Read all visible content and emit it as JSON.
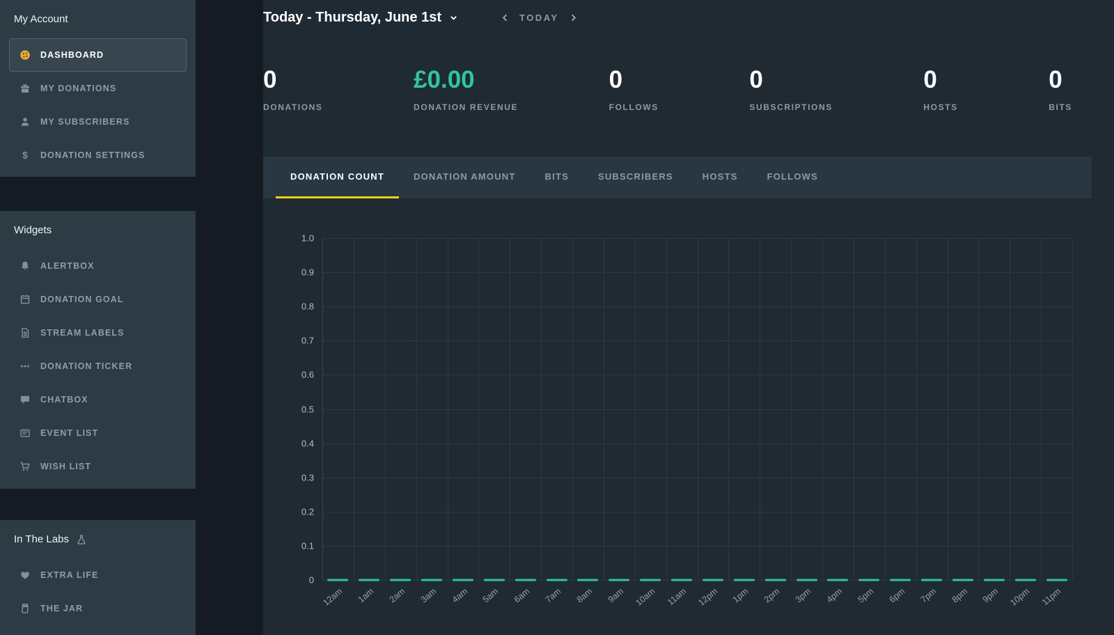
{
  "colors": {
    "teal": "#31c3a2",
    "yellow": "#f8ce15",
    "dashboard_orange": "#eca92c"
  },
  "sidebar": {
    "sections": [
      {
        "title": "My Account",
        "items": [
          {
            "label": "DASHBOARD",
            "icon": "dashboard-icon",
            "active": true
          },
          {
            "label": "MY DONATIONS",
            "icon": "gift-icon",
            "active": false
          },
          {
            "label": "MY SUBSCRIBERS",
            "icon": "person-icon",
            "active": false
          },
          {
            "label": "DONATION SETTINGS",
            "icon": "dollar-icon",
            "active": false
          }
        ]
      },
      {
        "title": "Widgets",
        "items": [
          {
            "label": "ALERTBOX",
            "icon": "bell-icon",
            "active": false
          },
          {
            "label": "DONATION GOAL",
            "icon": "calendar-icon",
            "active": false
          },
          {
            "label": "STREAM LABELS",
            "icon": "document-icon",
            "active": false
          },
          {
            "label": "DONATION TICKER",
            "icon": "ticker-icon",
            "active": false
          },
          {
            "label": "CHATBOX",
            "icon": "chat-icon",
            "active": false
          },
          {
            "label": "EVENT LIST",
            "icon": "list-icon",
            "active": false
          },
          {
            "label": "WISH LIST",
            "icon": "cart-icon",
            "active": false
          }
        ]
      },
      {
        "title": "In The Labs",
        "title_icon": "flask-icon",
        "items": [
          {
            "label": "EXTRA LIFE",
            "icon": "heart-icon",
            "active": false
          },
          {
            "label": "THE JAR",
            "icon": "jar-icon",
            "active": false
          }
        ]
      }
    ]
  },
  "header": {
    "date_label": "Today - Thursday, June 1st",
    "today_label": "TODAY"
  },
  "stats": [
    {
      "value": "0",
      "label": "DONATIONS",
      "accent": false
    },
    {
      "value": "£0.00",
      "label": "DONATION REVENUE",
      "accent": true
    },
    {
      "value": "0",
      "label": "FOLLOWS",
      "accent": false
    },
    {
      "value": "0",
      "label": "SUBSCRIPTIONS",
      "accent": false
    },
    {
      "value": "0",
      "label": "HOSTS",
      "accent": false
    },
    {
      "value": "0",
      "label": "BITS",
      "accent": false
    }
  ],
  "tabs": [
    {
      "label": "DONATION COUNT",
      "active": true
    },
    {
      "label": "DONATION AMOUNT",
      "active": false
    },
    {
      "label": "BITS",
      "active": false
    },
    {
      "label": "SUBSCRIBERS",
      "active": false
    },
    {
      "label": "HOSTS",
      "active": false
    },
    {
      "label": "FOLLOWS",
      "active": false
    }
  ],
  "chart_data": {
    "type": "line",
    "title": "",
    "x": [
      "12am",
      "1am",
      "2am",
      "3am",
      "4am",
      "5am",
      "6am",
      "7am",
      "8am",
      "9am",
      "10am",
      "11am",
      "12pm",
      "1pm",
      "2pm",
      "3pm",
      "4pm",
      "5pm",
      "6pm",
      "7pm",
      "8pm",
      "9pm",
      "10pm",
      "11pm"
    ],
    "series": [
      {
        "name": "Donation Count",
        "values": [
          0,
          0,
          0,
          0,
          0,
          0,
          0,
          0,
          0,
          0,
          0,
          0,
          0,
          0,
          0,
          0,
          0,
          0,
          0,
          0,
          0,
          0,
          0,
          0
        ]
      }
    ],
    "ylim": [
      0,
      1
    ],
    "ytick_labels": [
      "1.0",
      "0.9",
      "0.8",
      "0.7",
      "0.6",
      "0.5",
      "0.4",
      "0.3",
      "0.2",
      "0.1",
      "0"
    ],
    "grid": true,
    "legend": "none",
    "line_color": "#31c3a2"
  }
}
